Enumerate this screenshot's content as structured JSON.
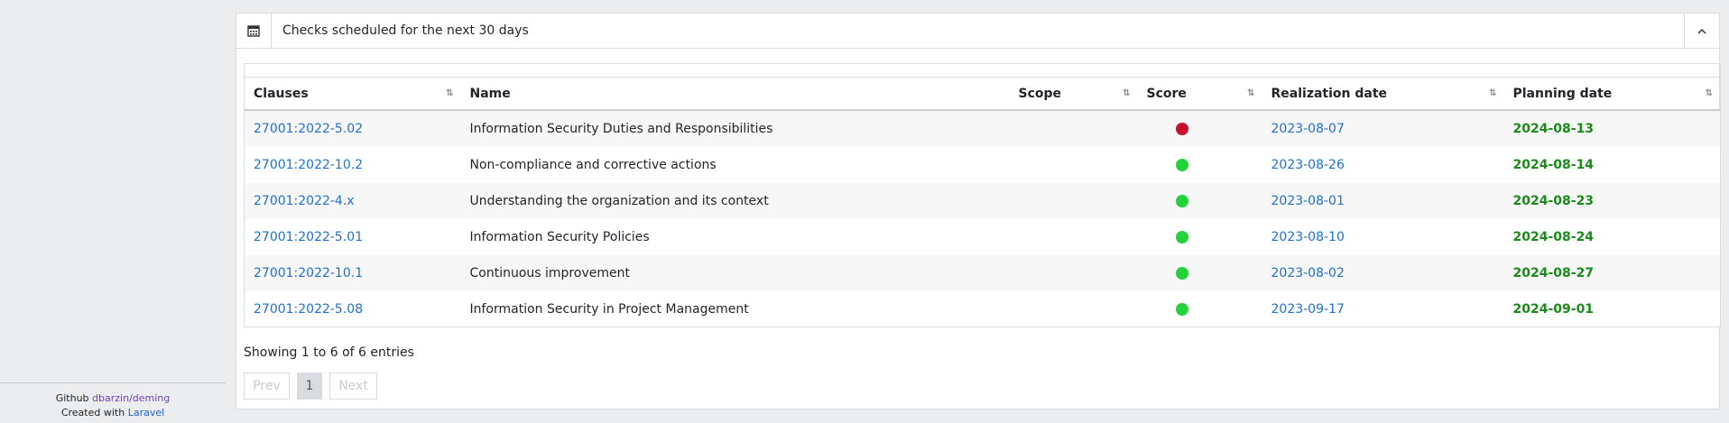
{
  "sidebar_footer": {
    "github_prefix": "Github",
    "github_link": "dbarzin/deming",
    "created_prefix": "Created with",
    "created_link": "Laravel"
  },
  "card": {
    "title": "Checks scheduled for the next 30 days",
    "icon": "calendar-icon",
    "collapse_icon": "chevron-up-icon"
  },
  "table": {
    "headers": {
      "clauses": "Clauses",
      "name": "Name",
      "scope": "Scope",
      "score": "Score",
      "realization": "Realization date",
      "planning": "Planning date"
    },
    "rows": [
      {
        "clause": "27001:2022-5.02",
        "name": "Information Security Duties and Responsibilities",
        "scope": "",
        "score": "bad",
        "realization": "2023-08-07",
        "planning": "2024-08-13"
      },
      {
        "clause": "27001:2022-10.2",
        "name": "Non-compliance and corrective actions",
        "scope": "",
        "score": "good",
        "realization": "2023-08-26",
        "planning": "2024-08-14"
      },
      {
        "clause": "27001:2022-4.x",
        "name": "Understanding the organization and its context",
        "scope": "",
        "score": "good",
        "realization": "2023-08-01",
        "planning": "2024-08-23"
      },
      {
        "clause": "27001:2022-5.01",
        "name": "Information Security Policies",
        "scope": "",
        "score": "good",
        "realization": "2023-08-10",
        "planning": "2024-08-24"
      },
      {
        "clause": "27001:2022-10.1",
        "name": "Continuous improvement",
        "scope": "",
        "score": "good",
        "realization": "2023-08-02",
        "planning": "2024-08-27"
      },
      {
        "clause": "27001:2022-5.08",
        "name": "Information Security in Project Management",
        "scope": "",
        "score": "good",
        "realization": "2023-09-17",
        "planning": "2024-09-01"
      }
    ]
  },
  "info": "Showing 1 to 6 of 6 entries",
  "pager": {
    "prev": "Prev",
    "page": "1",
    "next": "Next"
  },
  "colors": {
    "good": "#22d43a",
    "bad": "#c8102e",
    "link": "#1f6fd1",
    "planning": "#1a8a1a"
  }
}
